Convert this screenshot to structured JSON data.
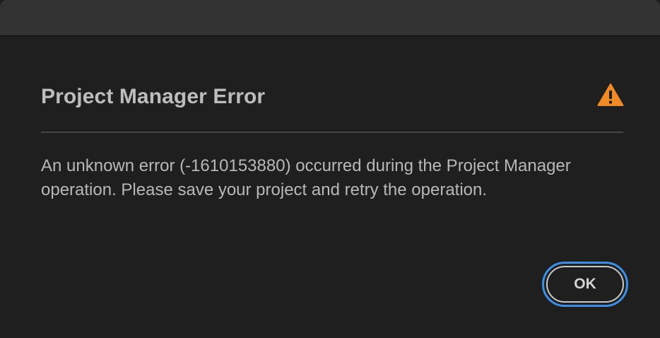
{
  "dialog": {
    "title": "Project Manager Error",
    "icon": "warning-icon",
    "message": "An unknown error (-1610153880) occurred during the Project Manager operation. Please save your project and retry the operation.",
    "ok_label": "OK"
  },
  "colors": {
    "background": "#1f1f1f",
    "titlebar": "#333333",
    "warning": "#f08a24",
    "focus_ring": "#3a8fe6"
  }
}
